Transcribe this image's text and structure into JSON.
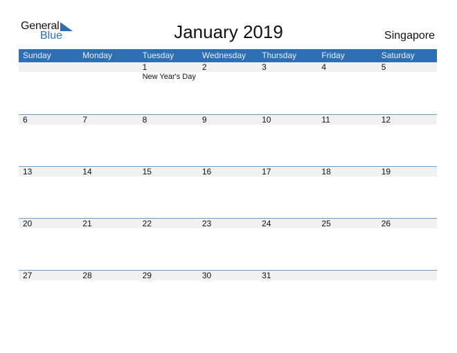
{
  "logo": {
    "line1": "General",
    "line2": "Blue"
  },
  "title": "January 2019",
  "country": "Singapore",
  "weekdays": [
    "Sunday",
    "Monday",
    "Tuesday",
    "Wednesday",
    "Thursday",
    "Friday",
    "Saturday"
  ],
  "weeks": [
    {
      "days": [
        "",
        "",
        "1",
        "2",
        "3",
        "4",
        "5"
      ],
      "events": [
        "",
        "",
        "New Year's Day",
        "",
        "",
        "",
        ""
      ]
    },
    {
      "days": [
        "6",
        "7",
        "8",
        "9",
        "10",
        "11",
        "12"
      ],
      "events": [
        "",
        "",
        "",
        "",
        "",
        "",
        ""
      ]
    },
    {
      "days": [
        "13",
        "14",
        "15",
        "16",
        "17",
        "18",
        "19"
      ],
      "events": [
        "",
        "",
        "",
        "",
        "",
        "",
        ""
      ]
    },
    {
      "days": [
        "20",
        "21",
        "22",
        "23",
        "24",
        "25",
        "26"
      ],
      "events": [
        "",
        "",
        "",
        "",
        "",
        "",
        ""
      ]
    },
    {
      "days": [
        "27",
        "28",
        "29",
        "30",
        "31",
        "",
        ""
      ],
      "events": [
        "",
        "",
        "",
        "",
        "",
        "",
        ""
      ]
    }
  ],
  "colors": {
    "header": "#2e6fb3",
    "brand": "#2a6fb5",
    "strip": "#f1f1f1",
    "rule": "#6a9ccd"
  }
}
